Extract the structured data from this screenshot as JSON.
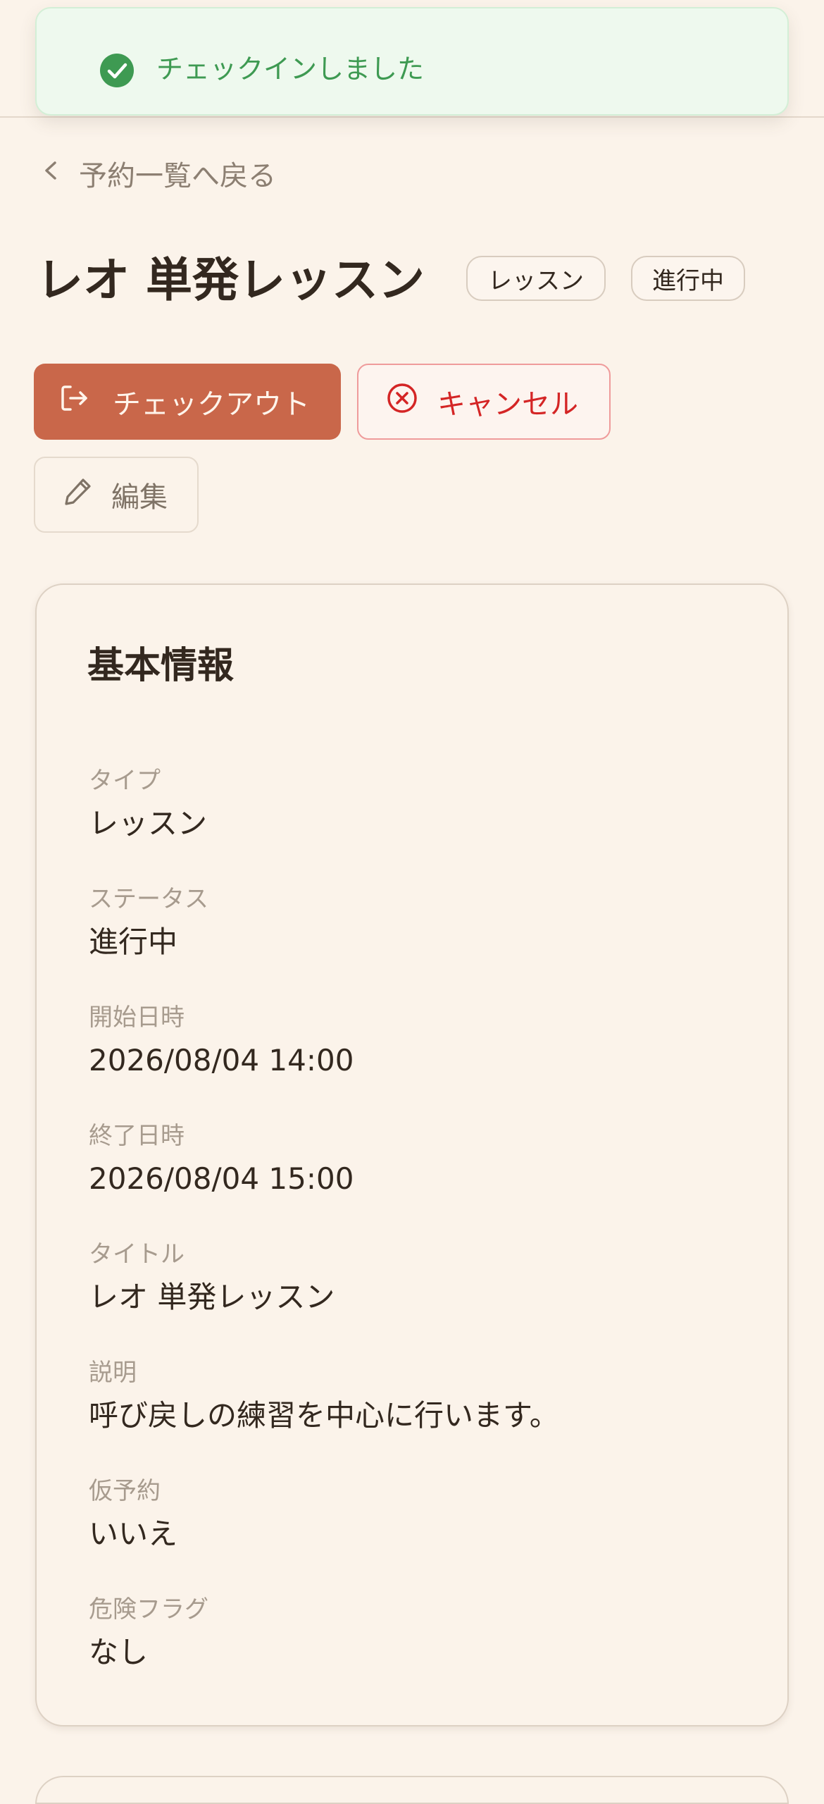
{
  "toast": {
    "message": "チェックインしました",
    "color": "#3e9a52"
  },
  "nav": {
    "back_label": "予約一覧へ戻る"
  },
  "booking": {
    "title": "レオ 単発レッスン",
    "badges": {
      "type": "レッスン",
      "status": "進行中"
    }
  },
  "actions": {
    "checkout_label": "チェックアウト",
    "cancel_label": "キャンセル",
    "edit_label": "編集",
    "checkout_color": "#c9674a",
    "cancel_color": "#d42525"
  },
  "basic_info": {
    "heading": "基本情報",
    "fields": [
      {
        "label": "タイプ",
        "value": "レッスン"
      },
      {
        "label": "ステータス",
        "value": "進行中"
      },
      {
        "label": "開始日時",
        "value": "2026/08/04 14:00"
      },
      {
        "label": "終了日時",
        "value": "2026/08/04 15:00"
      },
      {
        "label": "タイトル",
        "value": "レオ 単発レッスン"
      },
      {
        "label": "説明",
        "value": "呼び戻しの練習を中心に行います。"
      },
      {
        "label": "仮予約",
        "value": "いいえ"
      },
      {
        "label": "危険フラグ",
        "value": "なし"
      }
    ]
  }
}
